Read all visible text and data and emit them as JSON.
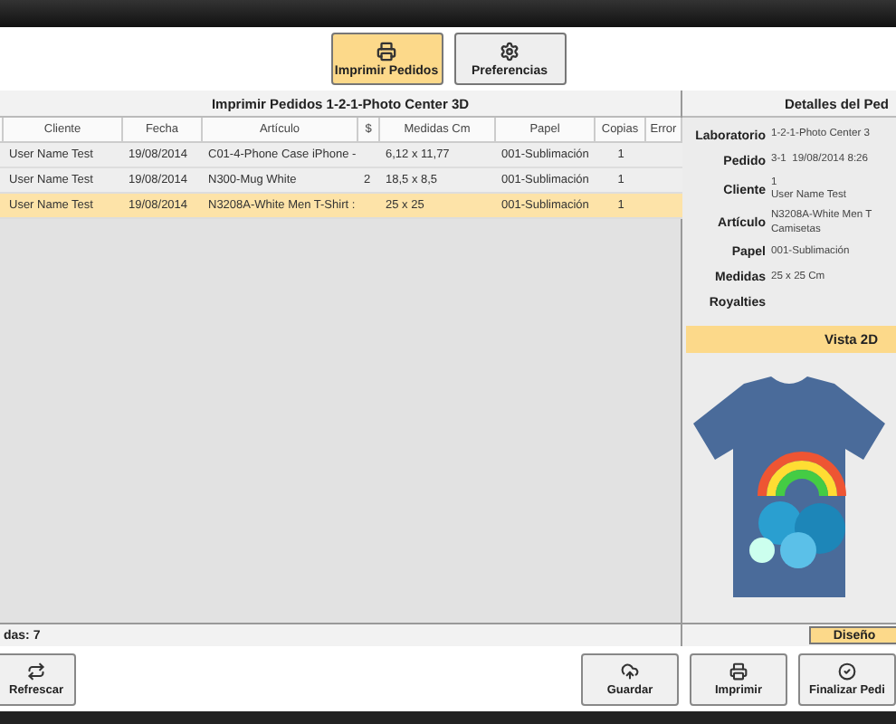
{
  "toolbar": [
    {
      "label": "Imprimir Pedidos",
      "kind": "printer",
      "selected": true
    },
    {
      "label": "Preferencias",
      "kind": "gear",
      "selected": false
    }
  ],
  "orders": {
    "title": "Imprimir Pedidos 1-2-1-Photo Center 3D",
    "columns": [
      "",
      "Cliente",
      "Fecha",
      "Artículo",
      "$",
      "Medidas Cm",
      "Papel",
      "Copias",
      "Error"
    ],
    "rows": [
      {
        "cells": [
          "",
          "User Name Test",
          "19/08/2014",
          "C01-4-Phone Case iPhone -",
          "",
          "6,12 x 11,77",
          "001-Sublimación",
          "1",
          ""
        ],
        "selected": false
      },
      {
        "cells": [
          "",
          "User Name Test",
          "19/08/2014",
          "N300-Mug White",
          "2",
          "18,5 x 8,5",
          "001-Sublimación",
          "1",
          ""
        ],
        "selected": false
      },
      {
        "cells": [
          "",
          "User Name Test",
          "19/08/2014",
          "N3208A-White Men T-Shirt :",
          "",
          "25 x 25",
          "001-Sublimación",
          "1",
          ""
        ],
        "selected": true
      }
    ],
    "status": "das: 7"
  },
  "details": {
    "title": "Detalles del Ped",
    "fields": [
      {
        "label": "Laboratorio",
        "lines": [
          "1-2-1-Photo Center 3"
        ]
      },
      {
        "label": "Pedido",
        "lines": [
          "3-1  19/08/2014 8:26"
        ]
      },
      {
        "label": "Cliente",
        "lines": [
          "1",
          "User Name Test"
        ]
      },
      {
        "label": "Artículo",
        "lines": [
          "N3208A-White Men T",
          "Camisetas"
        ]
      },
      {
        "label": "Papel",
        "lines": [
          "001-Sublimación"
        ]
      },
      {
        "label": "Medidas",
        "lines": [
          "25 x 25 Cm"
        ]
      },
      {
        "label": "Royalties"
      }
    ],
    "preview_title": "Vista 2D",
    "design_button": "Diseño"
  },
  "footer": {
    "left": [
      {
        "label": "Refrescar",
        "kind": "refresh"
      }
    ],
    "right": [
      {
        "label": "Guardar",
        "kind": "cloud"
      },
      {
        "label": "Imprimir",
        "kind": "printer"
      },
      {
        "label": "Finalizar Pedi",
        "kind": "check"
      }
    ]
  }
}
